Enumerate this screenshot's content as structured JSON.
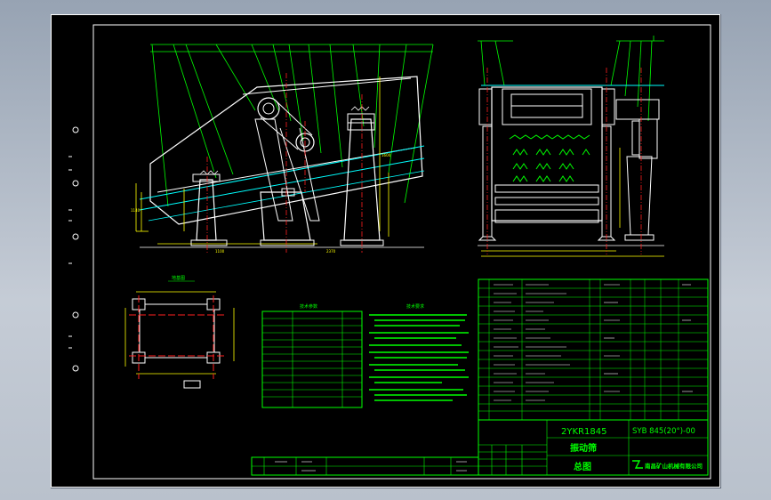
{
  "drawing": {
    "model": "2YKR1845",
    "name": "振动筛",
    "view": "总图",
    "drawing_number": "SYB 845(20°)-00",
    "company": "南昌矿山机械有限公司"
  },
  "sections": {
    "tech_params_title": "技术参数",
    "tech_requirements_title": "技术要求",
    "base_plan_title": "地基图"
  },
  "colors": {
    "background": "#000000",
    "linework": "#ffffff",
    "annotation": "#00ff00",
    "centerline": "#ff2020",
    "dimension": "#ffff00",
    "material_line": "#00ffff",
    "chrome": "#b6bfcb"
  }
}
